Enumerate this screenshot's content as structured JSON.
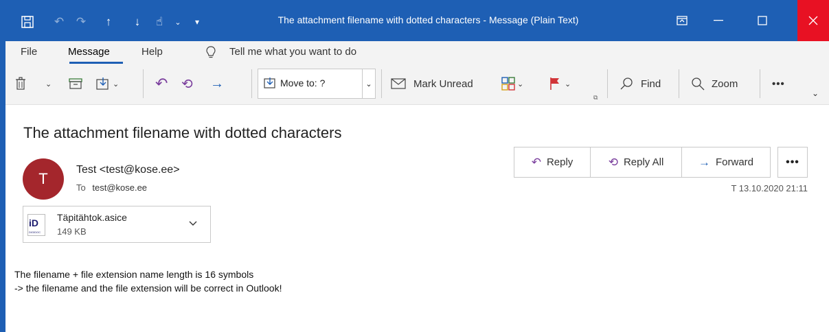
{
  "window": {
    "title": "The attachment filename with dotted characters  -  Message (Plain Text)",
    "quick_access": [
      "save-icon",
      "undo-icon",
      "redo-icon",
      "up-arrow-icon",
      "down-arrow-icon",
      "touch-mode-icon",
      "customize-icon"
    ],
    "controls": [
      "ribbon-display-icon",
      "minimize-icon",
      "maximize-icon",
      "close-icon"
    ]
  },
  "menu": {
    "items": [
      "File",
      "Message",
      "Help"
    ],
    "active": "Message",
    "tell_me": "Tell me what you want to do"
  },
  "ribbon": {
    "move_to": "Move to: ?",
    "mark_unread": "Mark Unread",
    "find": "Find",
    "zoom": "Zoom",
    "more": "•••"
  },
  "message": {
    "subject": "The attachment filename with dotted characters",
    "avatar_initial": "T",
    "sender": "Test <test@kose.ee>",
    "to_label": "To",
    "to_address": "test@kose.ee",
    "date": "T 13.10.2020 21:11",
    "actions": {
      "reply": "Reply",
      "reply_all": "Reply All",
      "forward": "Forward",
      "more": "•••"
    },
    "attachment": {
      "name": "Täpitähtok.asice",
      "size": "149 KB",
      "icon_text": "iD",
      "icon_subtext": "DIGIDOC"
    },
    "body": [
      "The filename + file extension name length is 16 symbols",
      "-> the filename and the file extension will be correct in Outlook!"
    ]
  },
  "colors": {
    "accent": "#1e5fb4",
    "close": "#e81123",
    "avatar": "#a4262c",
    "reply_icon": "#7a3e9d"
  }
}
